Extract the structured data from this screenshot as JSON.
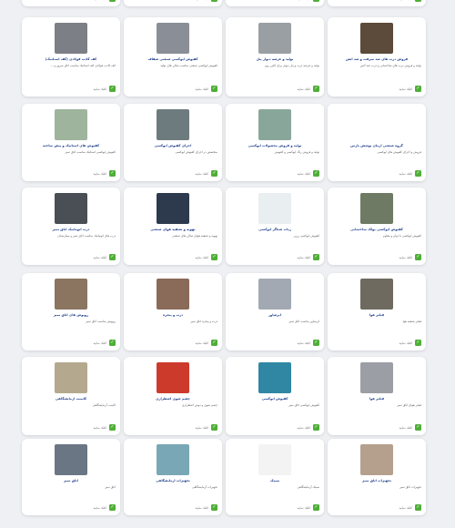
{
  "cards": [
    {
      "row": 0,
      "col": 0,
      "title": "",
      "desc": "",
      "thumb": "#ffffff",
      "footer": "کلیک نمایید"
    },
    {
      "row": 0,
      "col": 1,
      "title": "",
      "desc": "",
      "thumb": "#ffffff",
      "footer": "کلیک نمایید"
    },
    {
      "row": 0,
      "col": 2,
      "title": "",
      "desc": "",
      "thumb": "#ffffff",
      "footer": "کلیک نمایید"
    },
    {
      "row": 0,
      "col": 3,
      "title": "",
      "desc": "",
      "thumb": "#ffffff",
      "footer": "کلیک نمایید"
    },
    {
      "row": 1,
      "col": 0,
      "title": "کف کاذب فولادی (کف استاتیک)",
      "desc": "کف کاذب فولادی کف استاتیک مناسب اتاق سرور و ...",
      "thumb": "#7d7f86",
      "footer": "کلیک نمایید"
    },
    {
      "row": 1,
      "col": 1,
      "title": "کفپوش اپوکسی صنعتی شفاف",
      "desc": "کفپوش اپوکسی صنعتی مناسب سالن های تولید",
      "thumb": "#8a8f97",
      "footer": "کلیک نمایید"
    },
    {
      "row": 1,
      "col": 2,
      "title": "تولید و عرضه دیوار پنل",
      "desc": "تولید و عرضه درب و پنل دیوار برای کلین روم",
      "thumb": "#9a9fa4",
      "footer": "کلیک نمایید"
    },
    {
      "row": 1,
      "col": 3,
      "title": "فروش درب های ضد سرقت و ضد آتش",
      "desc": "تولید و فروش درب های ساختمانی و درب ضد آتش",
      "thumb": "#5c4a3a",
      "footer": "کلیک نمایید"
    },
    {
      "row": 2,
      "col": 0,
      "title": "کفپوش های استاتیک و پیش ساخته",
      "desc": "کفپوش اپوکسی استاتیک مناسب اتاق تمیز",
      "thumb": "#9eb49c",
      "footer": "کلیک نمایید"
    },
    {
      "row": 2,
      "col": 1,
      "title": "اجرای کفپوش اپوکسی",
      "desc": "متخصص در اجرای کفپوش اپوکسی",
      "thumb": "#6e7b7e",
      "footer": "کلیک نمایید"
    },
    {
      "row": 2,
      "col": 2,
      "title": "تولید و فروش محصولات اپوکسی",
      "desc": "تولید و فروش رنگ اپوکسی و کفپوش",
      "thumb": "#88a79a",
      "footer": "کلیک نمایید"
    },
    {
      "row": 2,
      "col": 3,
      "title": "گروه صنعتی آرمان پوشش پارس",
      "desc": "فروش و اجرای کفپوش های اپوکسی",
      "thumb": "#ffffff",
      "footer": "کلیک نمایید"
    },
    {
      "row": 3,
      "col": 0,
      "title": "درب اتوماتیک اتاق تمیز",
      "desc": "درب های اتوماتیک مناسب اتاق تمیز و بیمارستان",
      "thumb": "#4a4e55",
      "footer": "کلیک نمایید"
    },
    {
      "row": 3,
      "col": 1,
      "title": "تهویه و تصفیه هوای صنعتی",
      "desc": "تهویه و تصفیه هوای سالن های صنعتی",
      "thumb": "#2d3a4e",
      "footer": "کلیک نمایید"
    },
    {
      "row": 3,
      "col": 2,
      "title": "ربات شناگر اپوکسی",
      "desc": "کفپوش اپوکسی رزین",
      "thumb": "#e9eef0",
      "footer": "کلیک نمایید"
    },
    {
      "row": 3,
      "col": 3,
      "title": "کفپوش اپوکسی پولک ساختمانی",
      "desc": "کفپوش اپوکسی با دوام و مقاوم",
      "thumb": "#6f7a64",
      "footer": "کلیک نمایید"
    },
    {
      "row": 4,
      "col": 0,
      "title": "روپوش های اتاق تمیز",
      "desc": "روپوش مناسب اتاق تمیز",
      "thumb": "#8b7560",
      "footer": "کلیک نمایید"
    },
    {
      "row": 4,
      "col": 1,
      "title": "درب و پنجره",
      "desc": "درب و پنجره اتاق تمیز",
      "thumb": "#8a6a58",
      "footer": "کلیک نمایید"
    },
    {
      "row": 4,
      "col": 2,
      "title": "ایرشاور",
      "desc": "ایرشاور مناسب اتاق تمیز",
      "thumb": "#a3a9b3",
      "footer": "کلیک نمایید"
    },
    {
      "row": 4,
      "col": 3,
      "title": "فیلتر هوا",
      "desc": "فیلتر تصفیه هوا",
      "thumb": "#6e6a60",
      "footer": "کلیک نمایید"
    },
    {
      "row": 5,
      "col": 0,
      "title": "کابینت آزمایشگاهی",
      "desc": "کابینت آزمایشگاهی",
      "thumb": "#b4a88f",
      "footer": "کلیک نمایید"
    },
    {
      "row": 5,
      "col": 1,
      "title": "چشم شوی اضطراری",
      "desc": "چشم شوی و دوش اضطراری",
      "thumb": "#cc3a2b",
      "footer": "کلیک نمایید"
    },
    {
      "row": 5,
      "col": 2,
      "title": "کفپوش اپوکسی",
      "desc": "کفپوش اپوکسی اتاق تمیز",
      "thumb": "#2f87a3",
      "footer": "کلیک نمایید"
    },
    {
      "row": 5,
      "col": 3,
      "title": "فیلتر هوا",
      "desc": "فیلتر هوای اتاق تمیز",
      "thumb": "#9c9ea5",
      "footer": "کلیک نمایید"
    },
    {
      "row": 6,
      "col": 0,
      "title": "اتاق تمیز",
      "desc": "اتاق تمیز",
      "thumb": "#6b7685",
      "footer": "کلیک نمایید"
    },
    {
      "row": 6,
      "col": 1,
      "title": "تجهیزات آزمایشگاهی",
      "desc": "تجهیزات آزمایشگاهی",
      "thumb": "#7aa7b5",
      "footer": "کلیک نمایید"
    },
    {
      "row": 6,
      "col": 2,
      "title": "سینک",
      "desc": "سینک آزمایشگاهی",
      "thumb": "#f3f3f3",
      "footer": "کلیک نمایید"
    },
    {
      "row": 6,
      "col": 3,
      "title": "تجهیزات اتاق تمیز",
      "desc": "تجهیزات اتاق تمیز",
      "thumb": "#b5a08e",
      "footer": "کلیک نمایید"
    }
  ]
}
